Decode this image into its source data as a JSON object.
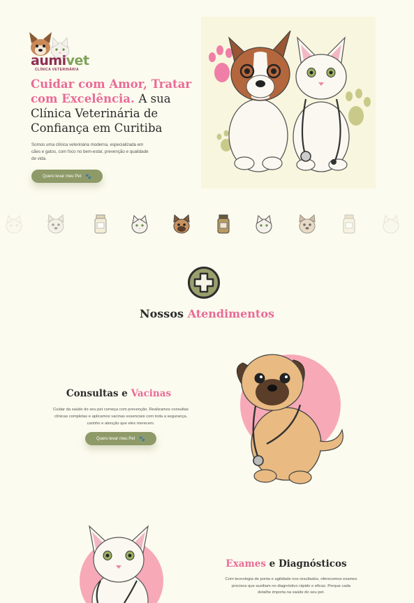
{
  "brand": {
    "name_part1": "aumi",
    "name_part2": "vet",
    "tagline": "CLÍNICA VETERINÁRIA"
  },
  "hero": {
    "title_highlight": "Cuidar com Amor, Tratar com Excelência.",
    "title_rest": "A sua Clínica Veterinária de Confiança em Curitiba",
    "description": "Somos uma clínica veterinária moderna, especializada em cães e gatos, com foco no bem-estar, prevenção e qualidade de vida.",
    "cta_label": "Quero levar meu Pet"
  },
  "icon_strip": [
    "cat-icon",
    "dog-icon",
    "medicine-bottle-icon",
    "cat-icon",
    "dog-icon",
    "medicine-bottle-icon",
    "cat-icon",
    "dog-icon",
    "medicine-bottle-icon",
    "cat-icon"
  ],
  "services_section": {
    "title_plain": "Nossos",
    "title_highlight": "Atendimentos"
  },
  "consultas": {
    "title_plain": "Consultas e",
    "title_highlight": "Vacinas",
    "description": "Cuidar da saúde do seu pet começa com prevenção. Realizamos consultas clínicas completas e aplicamos vacinas essenciais com toda a segurança, carinho e atenção que eles merecem.",
    "cta_label": "Quero levar meu Pet"
  },
  "exames": {
    "title_highlight": "Exames",
    "title_plain": "e Diagnósticos",
    "description": "Com tecnologia de ponta e agilidade nos resultados, oferecemos exames precisos que auxiliam no diagnóstico rápido e eficaz. Porque cada detalhe importa na saúde do seu pet."
  },
  "colors": {
    "background": "#fcfbef",
    "accent_pink": "#e96b97",
    "button_green": "#8e9a67",
    "brand_maroon": "#8d2d52"
  }
}
